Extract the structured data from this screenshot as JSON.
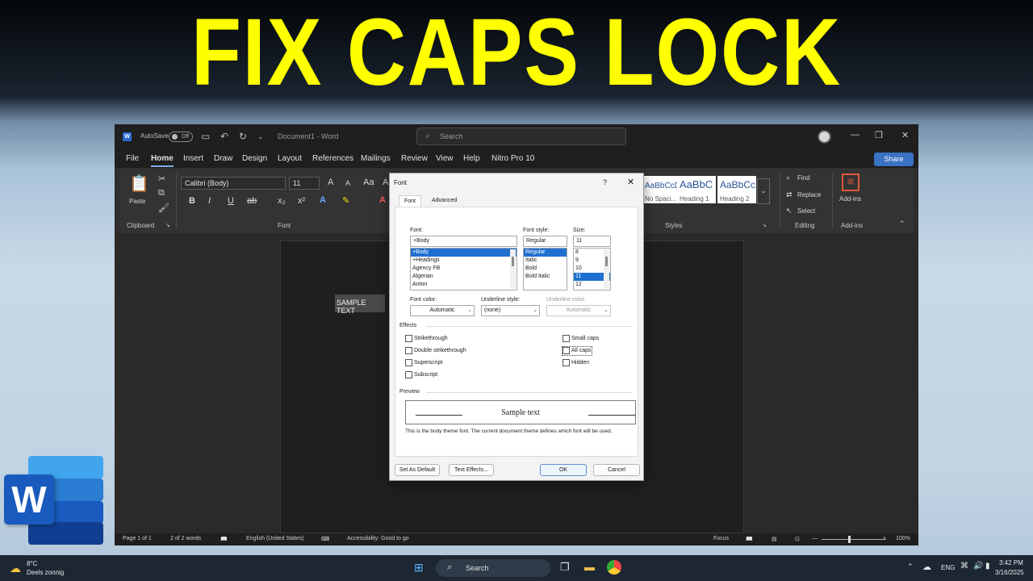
{
  "headline": "FIX CAPS LOCK",
  "word": {
    "titlebar": {
      "app_icon": "W",
      "autosave_label": "AutoSave",
      "autosave_state": "Off",
      "doc_title": "Document1  -  Word",
      "search_placeholder": "Search",
      "icons": [
        "save-icon",
        "undo-icon",
        "redo-icon",
        "customize-icon",
        "minimize-icon",
        "restore-icon",
        "close-icon"
      ]
    },
    "menu": [
      "File",
      "Home",
      "Insert",
      "Draw",
      "Design",
      "Layout",
      "References",
      "Mailings",
      "Review",
      "View",
      "Help",
      "Nitro Pro 10"
    ],
    "menu_active": "Home",
    "share_label": "Share",
    "ribbon": {
      "paste_label": "Paste",
      "clipboard_label": "Clipboard",
      "font_name": "Calibri (Body)",
      "font_size": "11",
      "font_label": "Font",
      "format_buttons": [
        "B",
        "I",
        "U",
        "x₂",
        "x²",
        "A",
        "A",
        "A"
      ],
      "styles": [
        {
          "preview": "AaBbCcDc",
          "name": "No Spaci..."
        },
        {
          "preview": "AaBbC",
          "name": "Heading 1"
        },
        {
          "preview": "AaBbCc",
          "name": "Heading 2"
        }
      ],
      "styles_label": "Styles",
      "find_label": "Find",
      "replace_label": "Replace",
      "select_label": "Select",
      "editing_label": "Editing",
      "addins_label": "Add-ins",
      "addins_group_label": "Add-ins"
    },
    "document": {
      "sample_text": "SAMPLE TEXT"
    },
    "status": {
      "page": "Page 1 of 1",
      "words": "2 of 2 words",
      "language": "English (United States)",
      "accessibility": "Accessibility: Good to go",
      "focus": "Focus",
      "zoom": "100%"
    }
  },
  "dialog": {
    "title": "Font",
    "help": "?",
    "close": "✕",
    "tabs": [
      "Font",
      "Advanced"
    ],
    "font_label": "Font:",
    "font_value": "+Body",
    "font_list": [
      "+Body",
      "+Headings",
      "Agency FB",
      "Algerian",
      "Anton"
    ],
    "style_label": "Font style:",
    "style_value": "Regular",
    "style_list": [
      "Regular",
      "Italic",
      "Bold",
      "Bold Italic"
    ],
    "size_label": "Size:",
    "size_value": "11",
    "size_list": [
      "8",
      "9",
      "10",
      "11",
      "12"
    ],
    "font_color_label": "Font color:",
    "font_color_value": "Automatic",
    "underline_style_label": "Underline style:",
    "underline_style_value": "(none)",
    "underline_color_label": "Underline color:",
    "underline_color_value": "Automatic",
    "effects_label": "Effects",
    "effects_left": [
      "Strikethrough",
      "Double strikethrough",
      "Superscript",
      "Subscript"
    ],
    "effects_right": [
      "Small caps",
      "All caps",
      "Hidden"
    ],
    "preview_label": "Preview",
    "preview_text": "Sample text",
    "note": "This is the body theme font. The current document theme defines which font will be used.",
    "buttons": {
      "default": "Set As Default",
      "effects": "Text Effects...",
      "ok": "OK",
      "cancel": "Cancel"
    }
  },
  "taskbar": {
    "weather_temp": "8°C",
    "weather_desc": "Deels zonnig",
    "search": "Search",
    "lang": "ENG",
    "time": "3:42 PM",
    "date": "3/16/2025"
  },
  "logo_letter": "W",
  "colors": {
    "headline": "#ffff00",
    "word_blue": "#185abd",
    "selection": "#1f6fd1"
  }
}
